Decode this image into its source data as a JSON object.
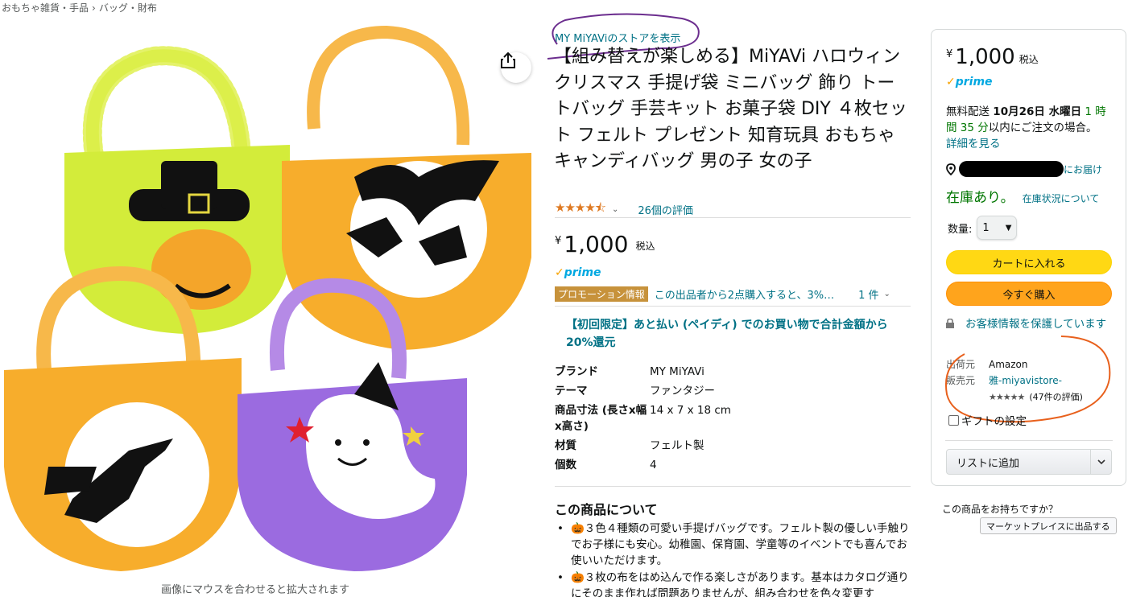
{
  "breadcrumb": [
    "おもちゃ雑貨・手品",
    "バッグ・財布"
  ],
  "breadcrumb_sep": "›",
  "image_zoom_hint": "画像にマウスを合わせると拡大されます",
  "product": {
    "store_link": "MY MiYAViのストアを表示",
    "title": "【組み替えが楽しめる】MiYAVi ハロウィン クリスマス 手提げ袋 ミニバッグ 飾り トートバッグ 手芸キット お菓子袋 DIY ４枚セット フェルト プレゼント 知育玩具 おもちゃ キャンディバッグ 男の子 女の子",
    "rating_stars": "★★★★⯪",
    "rating_value": 4.5,
    "rating_count": "26個の評価",
    "price_symbol": "¥",
    "price": "1,000",
    "tax_label": "税込",
    "prime": "prime",
    "promo_badge": "プロモーション情報",
    "promo_text": "この出品者から2点購入すると、3%…",
    "promo_count": "1 件",
    "first_time_offer": "【初回限定】あと払い (ペイディ) でのお買い物で合計金額から20%還元",
    "specs": [
      {
        "key": "ブランド",
        "value": "MY MiYAVi"
      },
      {
        "key": "テーマ",
        "value": "ファンタジー"
      },
      {
        "key": "商品寸法 (長さx幅x高さ)",
        "value": "14 x 7 x 18 cm"
      },
      {
        "key": "材質",
        "value": "フェルト製"
      },
      {
        "key": "個数",
        "value": "4"
      }
    ],
    "about_title": "この商品について",
    "bullets": [
      "🎃３色４種類の可愛い手提げバッグです。フェルト製の優しい手触りでお子様にも安心。幼稚園、保育園、学童等のイベントでも喜んでお使いいただけます。",
      "🎃３枚の布をはめ込んで作る楽しさがあります。基本はカタログ通りにそのまま作れば問題ありませんが、組み合わせを色々変更す"
    ]
  },
  "buybox": {
    "price_symbol": "¥",
    "price": "1,000",
    "tax_label": "税込",
    "prime": "prime",
    "delivery_prefix": "無料配送 ",
    "delivery_date": "10月26日 水曜日",
    "delivery_time": " 1 時間 35 分",
    "delivery_suffix": "以内にご注文の場合。",
    "delivery_details": "詳細を見る",
    "deliver_to_suffix": "にお届け",
    "in_stock": "在庫あり。",
    "stock_status_link": "在庫状況について",
    "qty_label": "数量:",
    "qty_value": "1",
    "add_to_cart": "カートに入れる",
    "buy_now": "今すぐ購入",
    "secure_text": "お客様情報を保護しています",
    "ships_from_label": "出荷元",
    "ships_from": "Amazon",
    "sold_by_label": "販売元",
    "sold_by": "雅-miyavistore-",
    "seller_stars": "★★★★★",
    "seller_reviews": "(47件の評価)",
    "gift_label": "ギフトの設定",
    "add_to_list": "リストに追加"
  },
  "have_one": "この商品をお持ちですか？",
  "sell_button": "マーケットプレイスに出品する",
  "colors": {
    "link": "#007185",
    "green": "#007600",
    "cart_button": "#ffd814",
    "buy_button": "#ffa41c",
    "promo_badge": "#c7923b",
    "annotation_purple": "#6b2d8e",
    "annotation_orange": "#e8601c"
  }
}
